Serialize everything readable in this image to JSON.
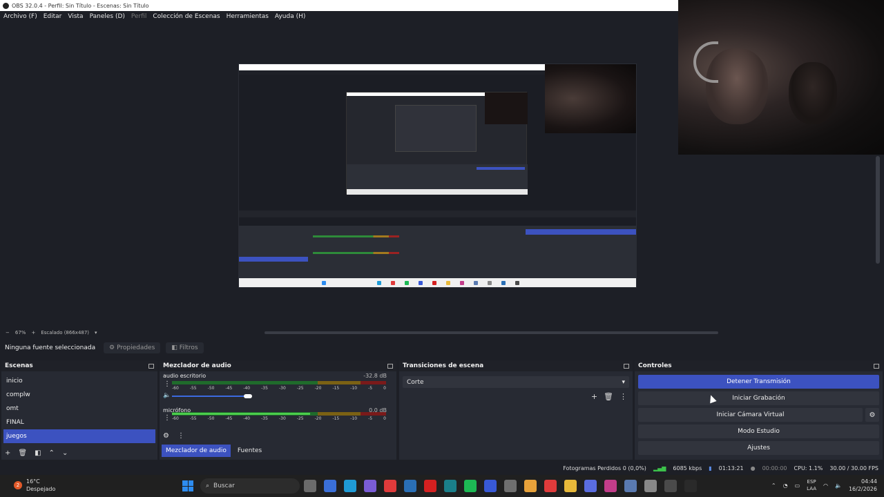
{
  "window": {
    "title": "OBS 32.0.4 - Perfil: Sin Título - Escenas: Sin Título"
  },
  "menu": {
    "items": [
      "Archivo (F)",
      "Editar",
      "Vista",
      "Paneles (D)",
      "Perfil",
      "Colección de Escenas",
      "Herramientas",
      "Ayuda (H)"
    ]
  },
  "preview_status": {
    "zoom": "67%",
    "scale": "Escalado (866x487)"
  },
  "source_bar": {
    "no_source": "Ninguna fuente seleccionada",
    "properties": "Propiedades",
    "filters": "Filtros"
  },
  "scenes": {
    "title": "Escenas",
    "items": [
      "inicio",
      "complw",
      "omt",
      "FINAL",
      "juegos"
    ],
    "active_index": 4
  },
  "mixer": {
    "title": "Mezclador de audio",
    "channels": [
      {
        "name": "audio escritorio",
        "db": "-32.8 dB"
      },
      {
        "name": "micrófono",
        "db": "0.0 dB"
      }
    ],
    "ticks": [
      "-60",
      "-55",
      "-50",
      "-45",
      "-40",
      "-35",
      "-30",
      "-25",
      "-20",
      "-15",
      "-10",
      "-5",
      "0"
    ],
    "tabs": [
      "Mezclador de audio",
      "Fuentes"
    ]
  },
  "transitions": {
    "title": "Transiciones de escena",
    "selected": "Corte"
  },
  "controls": {
    "title": "Controles",
    "stop_stream": "Detener Transmisión",
    "start_recording": "Iniciar Grabación",
    "virtual_cam": "Iniciar Cámara Virtual",
    "studio_mode": "Modo Estudio",
    "settings": "Ajustes"
  },
  "status": {
    "dropped": "Fotogramas Perdidos 0 (0,0%)",
    "bitrate": "6085 kbps",
    "live_time": "01:13:21",
    "rec_time": "00:00:00",
    "cpu": "CPU: 1.1%",
    "fps": "30.00 / 30.00 FPS"
  },
  "taskbar": {
    "temp": "16°C",
    "weather": "Despejado",
    "weather_badge": "2",
    "search_placeholder": "Buscar",
    "lang1": "ESP",
    "lang2": "LAA",
    "time": "04:44",
    "date": "16/2/2026",
    "app_colors": [
      "#6b6b6b",
      "#3a6fd8",
      "#1f9bd6",
      "#7a5cd6",
      "#e03b3b",
      "#2a6fb5",
      "#d42020",
      "#1a7f8a",
      "#1db954",
      "#3859d6",
      "#6f6f6f",
      "#e8a23a",
      "#e03b3b",
      "#e8b93a",
      "#5a6de0",
      "#c33d8a",
      "#5a7ab0",
      "#888888",
      "#4a4a4a",
      "#2a2a2a"
    ]
  },
  "colors": {
    "accent": "#3c52c0",
    "background": "#1d1f26",
    "panel": "#272a33"
  }
}
